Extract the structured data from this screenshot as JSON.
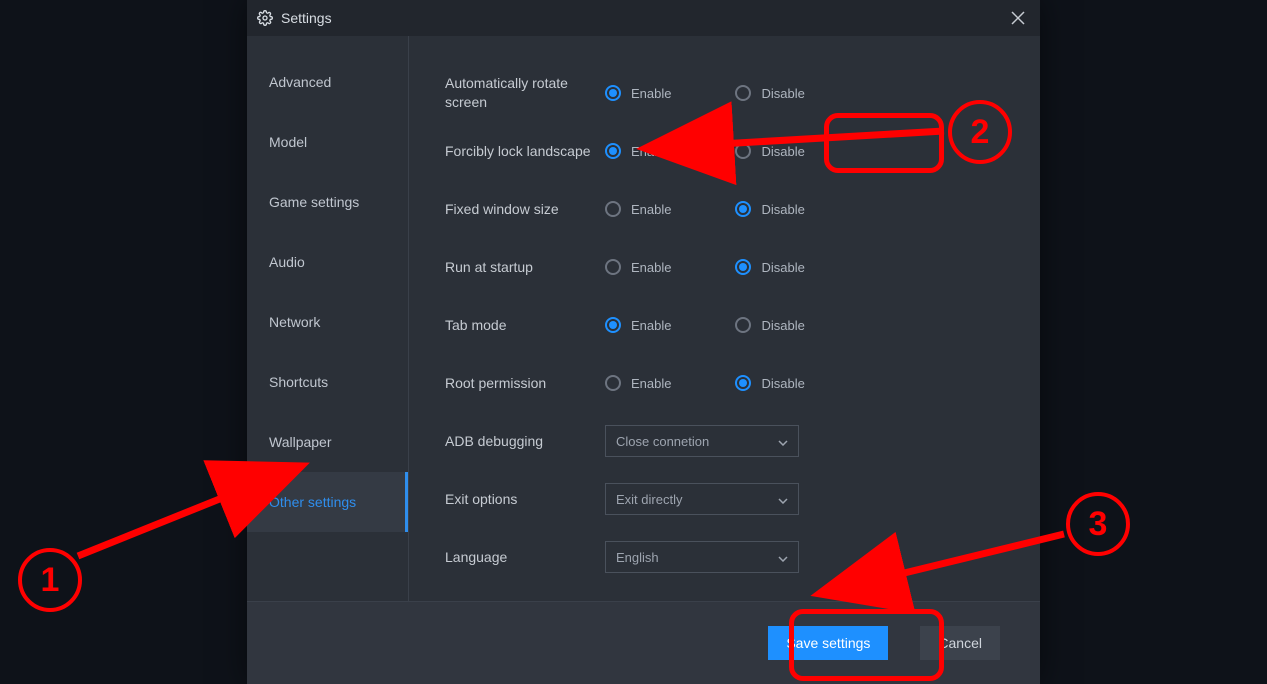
{
  "window": {
    "title": "Settings"
  },
  "sidebar": {
    "items": [
      {
        "label": "Advanced"
      },
      {
        "label": "Model"
      },
      {
        "label": "Game settings"
      },
      {
        "label": "Audio"
      },
      {
        "label": "Network"
      },
      {
        "label": "Shortcuts"
      },
      {
        "label": "Wallpaper"
      },
      {
        "label": "Other settings"
      }
    ],
    "active_index": 7
  },
  "labels": {
    "enable": "Enable",
    "disable": "Disable"
  },
  "settings": [
    {
      "key": "auto_rotate",
      "label": "Automatically rotate screen",
      "type": "radio",
      "value": "enable"
    },
    {
      "key": "lock_landscape",
      "label": "Forcibly lock landscape",
      "type": "radio",
      "value": "enable"
    },
    {
      "key": "fixed_window",
      "label": "Fixed window size",
      "type": "radio",
      "value": "disable"
    },
    {
      "key": "run_startup",
      "label": "Run at startup",
      "type": "radio",
      "value": "disable"
    },
    {
      "key": "tab_mode",
      "label": "Tab mode",
      "type": "radio",
      "value": "enable"
    },
    {
      "key": "root_perm",
      "label": "Root permission",
      "type": "radio",
      "value": "disable"
    },
    {
      "key": "adb_debug",
      "label": "ADB debugging",
      "type": "select",
      "value": "Close connetion"
    },
    {
      "key": "exit_opts",
      "label": "Exit options",
      "type": "select",
      "value": "Exit directly"
    },
    {
      "key": "language",
      "label": "Language",
      "type": "select",
      "value": "English"
    }
  ],
  "footer": {
    "save": "Save settings",
    "cancel": "Cancel"
  },
  "annotations": {
    "n1": "1",
    "n2": "2",
    "n3": "3"
  }
}
